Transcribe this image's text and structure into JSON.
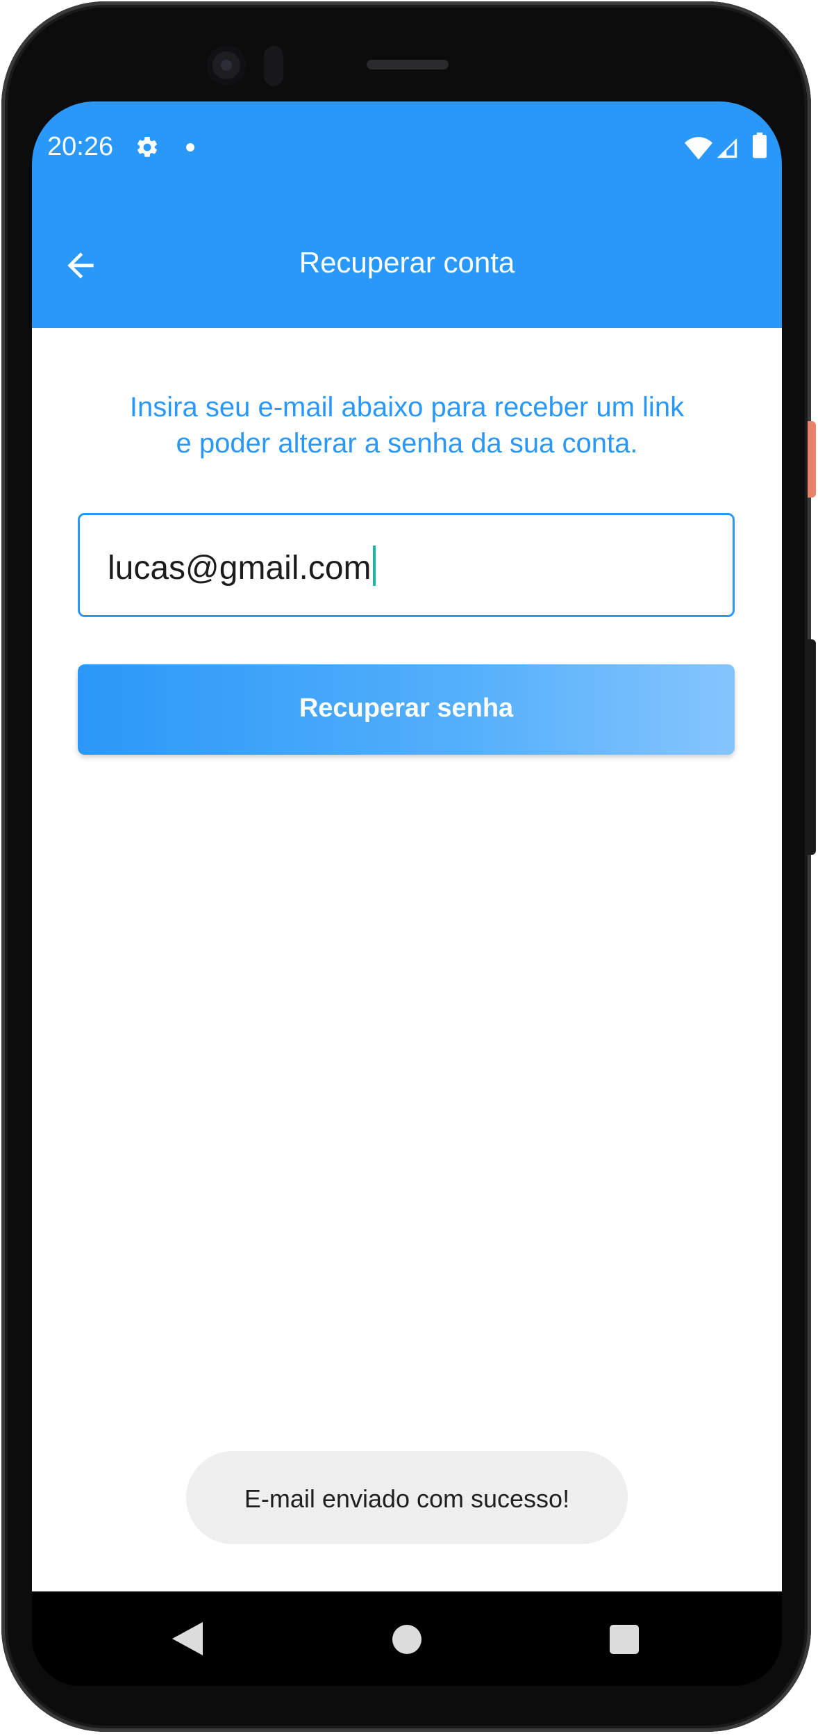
{
  "status_bar": {
    "time": "20:26",
    "icons": [
      "gear-icon",
      "notification-dot-icon",
      "wifi-icon",
      "signal-icon",
      "battery-icon"
    ]
  },
  "app_bar": {
    "title": "Recuperar conta",
    "back_icon": "arrow-left-icon"
  },
  "main": {
    "instructions_line1": "Insira seu e-mail abaixo para receber um link",
    "instructions_line2": "e poder alterar a senha da sua conta.",
    "email_value": "lucas@gmail.com",
    "recover_button_label": "Recuperar senha"
  },
  "toast": {
    "message": "E-mail enviado com sucesso!"
  },
  "nav_bar": {
    "icons": [
      "nav-back-icon",
      "nav-home-icon",
      "nav-recents-icon"
    ]
  },
  "colors": {
    "primary": "#2a98f8",
    "caret": "#17b8a6",
    "toast_background": "#efefef"
  }
}
